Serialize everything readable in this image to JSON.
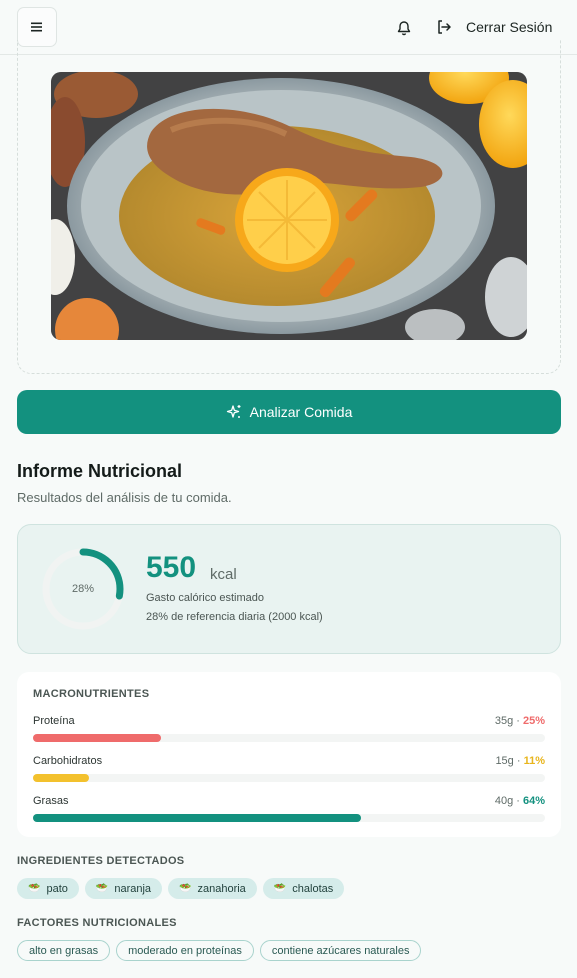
{
  "header": {
    "menu_icon": "menu-icon",
    "bell_icon": "bell-icon",
    "logout_icon": "logout-icon",
    "logout_label": "Cerrar Sesión"
  },
  "analyze_button": {
    "label": "Analizar Comida",
    "icon": "sparkles-icon"
  },
  "report": {
    "title": "Informe Nutricional",
    "subtitle": "Resultados del análisis de tu comida."
  },
  "calories": {
    "ring_percent_label": "28%",
    "ring_fraction": 0.28,
    "value": "550",
    "unit": "kcal",
    "description": "Gasto calórico estimado",
    "reference": "28% de referencia diaria (2000 kcal)",
    "accent_color": "#13917f"
  },
  "macros": {
    "title": "MACRONUTRIENTES",
    "items": [
      {
        "name": "Proteína",
        "grams": "35g",
        "sep": " · ",
        "percent": "25%",
        "fraction": 0.25,
        "color": "#ef6b6b"
      },
      {
        "name": "Carbohidratos",
        "grams": "15g",
        "sep": " · ",
        "percent": "11%",
        "fraction": 0.11,
        "color": "#f3c12d"
      },
      {
        "name": "Grasas",
        "grams": "40g",
        "sep": " · ",
        "percent": "64%",
        "fraction": 0.64,
        "color": "#13917f"
      }
    ]
  },
  "ingredients": {
    "title": "INGREDIENTES DETECTADOS",
    "items": [
      "pato",
      "naranja",
      "zanahoria",
      "chalotas"
    ],
    "icon": "salad-bowl-icon"
  },
  "factors": {
    "title": "FACTORES NUTRICIONALES",
    "items": [
      "alto en grasas",
      "moderado en proteínas",
      "contiene azúcares naturales"
    ]
  }
}
